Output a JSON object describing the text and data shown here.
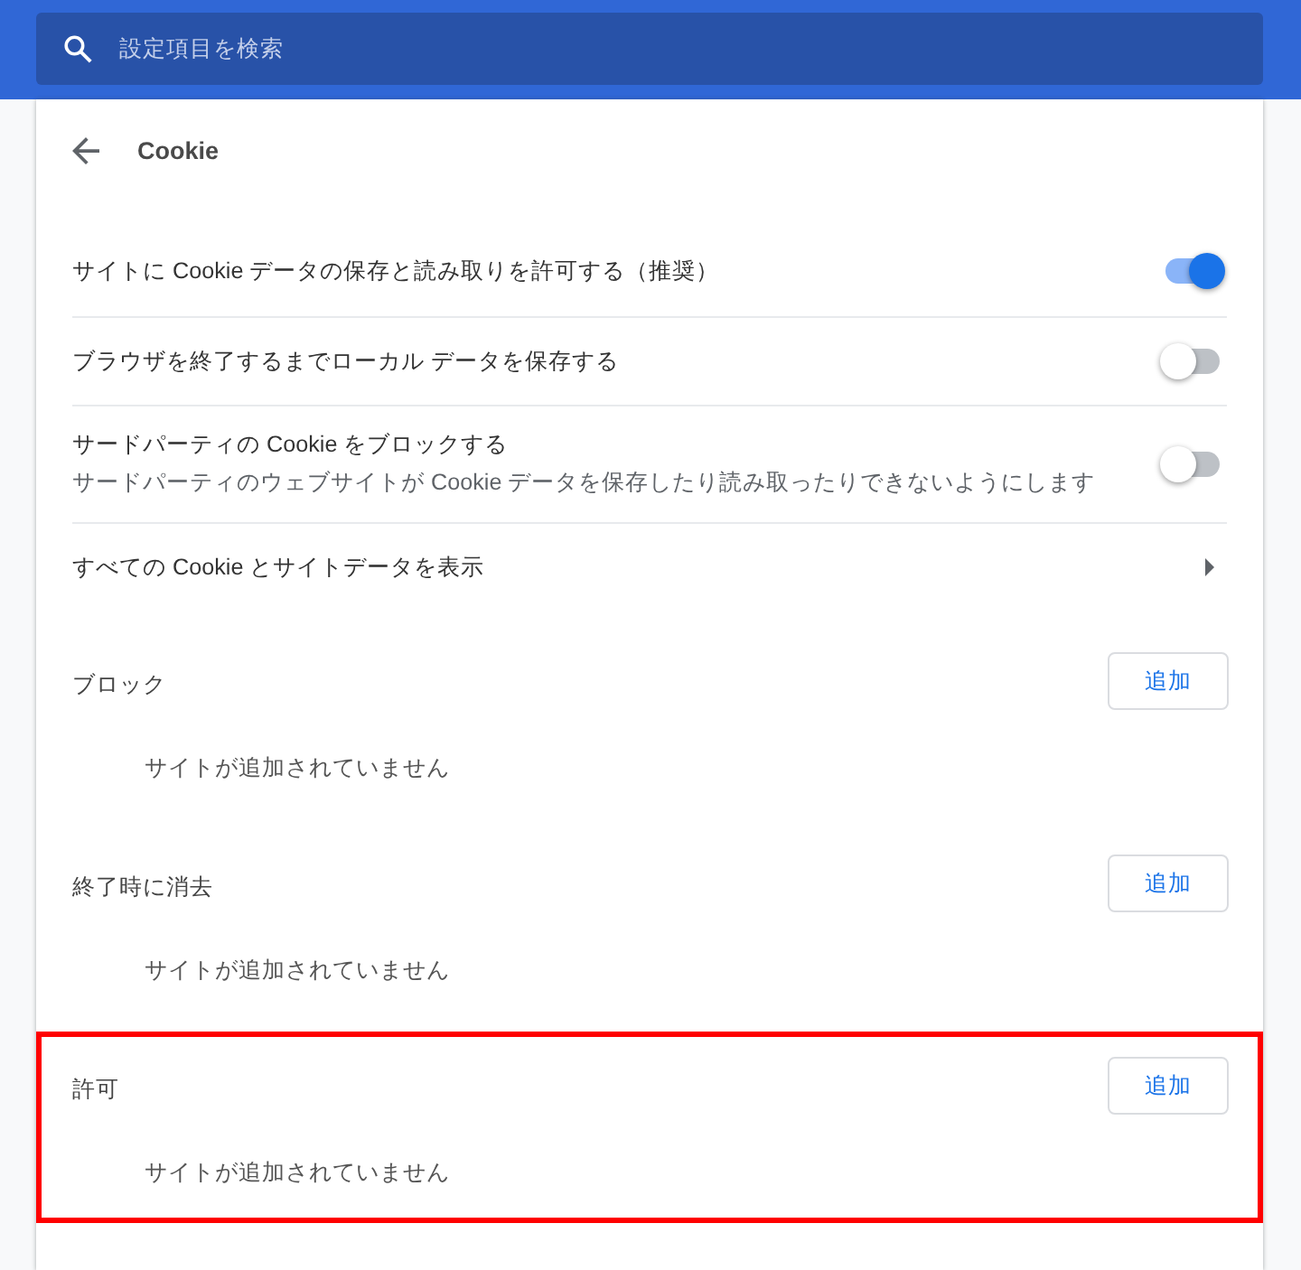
{
  "search": {
    "placeholder": "設定項目を検索"
  },
  "page": {
    "title": "Cookie"
  },
  "settings": [
    {
      "kind": "toggle",
      "label": "サイトに Cookie データの保存と読み取りを許可する（推奨）",
      "on": true
    },
    {
      "kind": "toggle",
      "label": "ブラウザを終了するまでローカル データを保存する",
      "on": false
    },
    {
      "kind": "toggle",
      "label": "サードパーティの Cookie をブロックする",
      "sublabel": "サードパーティのウェブサイトが Cookie データを保存したり読み取ったりできないようにします",
      "on": false
    },
    {
      "kind": "link",
      "label": "すべての Cookie とサイトデータを表示"
    }
  ],
  "sections": [
    {
      "title": "ブロック",
      "button": "追加",
      "empty_text": "サイトが追加されていません",
      "highlighted": false
    },
    {
      "title": "終了時に消去",
      "button": "追加",
      "empty_text": "サイトが追加されていません",
      "highlighted": false
    },
    {
      "title": "許可",
      "button": "追加",
      "empty_text": "サイトが追加されていません",
      "highlighted": true
    }
  ]
}
